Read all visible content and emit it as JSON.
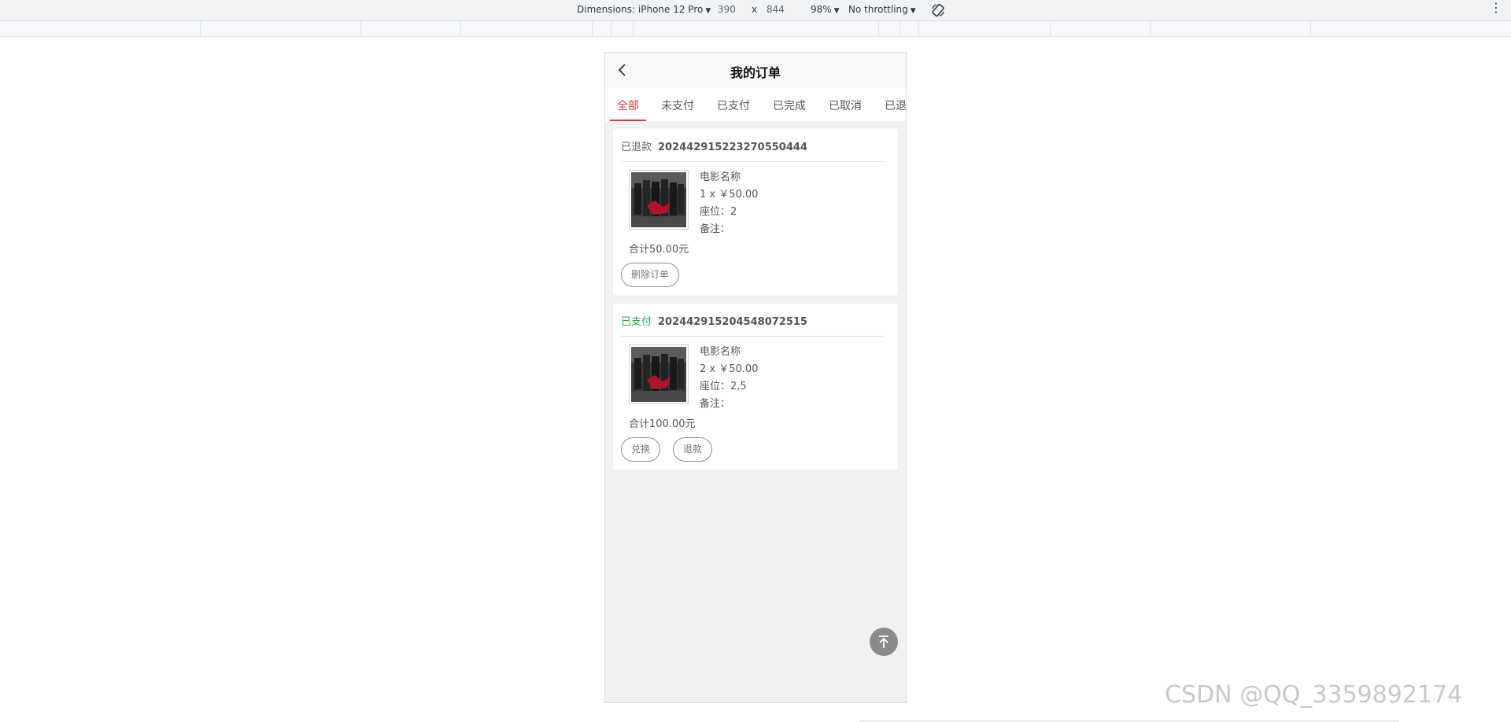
{
  "devtools": {
    "dimensions_label": "Dimensions: iPhone 12 Pro",
    "width": "390",
    "times": "x",
    "height": "844",
    "zoom": "98%",
    "throttling": "No throttling"
  },
  "app": {
    "title": "我的订单",
    "tabs": [
      {
        "label": "全部",
        "active": true
      },
      {
        "label": "未支付"
      },
      {
        "label": "已支付"
      },
      {
        "label": "已完成"
      },
      {
        "label": "已取消"
      },
      {
        "label": "已退款"
      }
    ],
    "orders": [
      {
        "status": "已退款",
        "order_no": "202442915223270550444",
        "movie": "电影名称",
        "qty_price": "1 x ￥50.00",
        "seat": "座位：2",
        "note": "备注：",
        "total": "合计50.00元",
        "buttons": [
          "删除订单"
        ]
      },
      {
        "status": "已支付",
        "order_no": "202442915204548072515",
        "movie": "电影名称",
        "qty_price": "2 x ￥50.00",
        "seat": "座位：2,5",
        "note": "备注：",
        "total": "合计100.00元",
        "buttons": [
          "兑换",
          "退款"
        ]
      }
    ]
  },
  "colors": {
    "accent": "#d23b3b",
    "paid": "#2aa445"
  },
  "watermark": "CSDN @QQ_3359892174"
}
